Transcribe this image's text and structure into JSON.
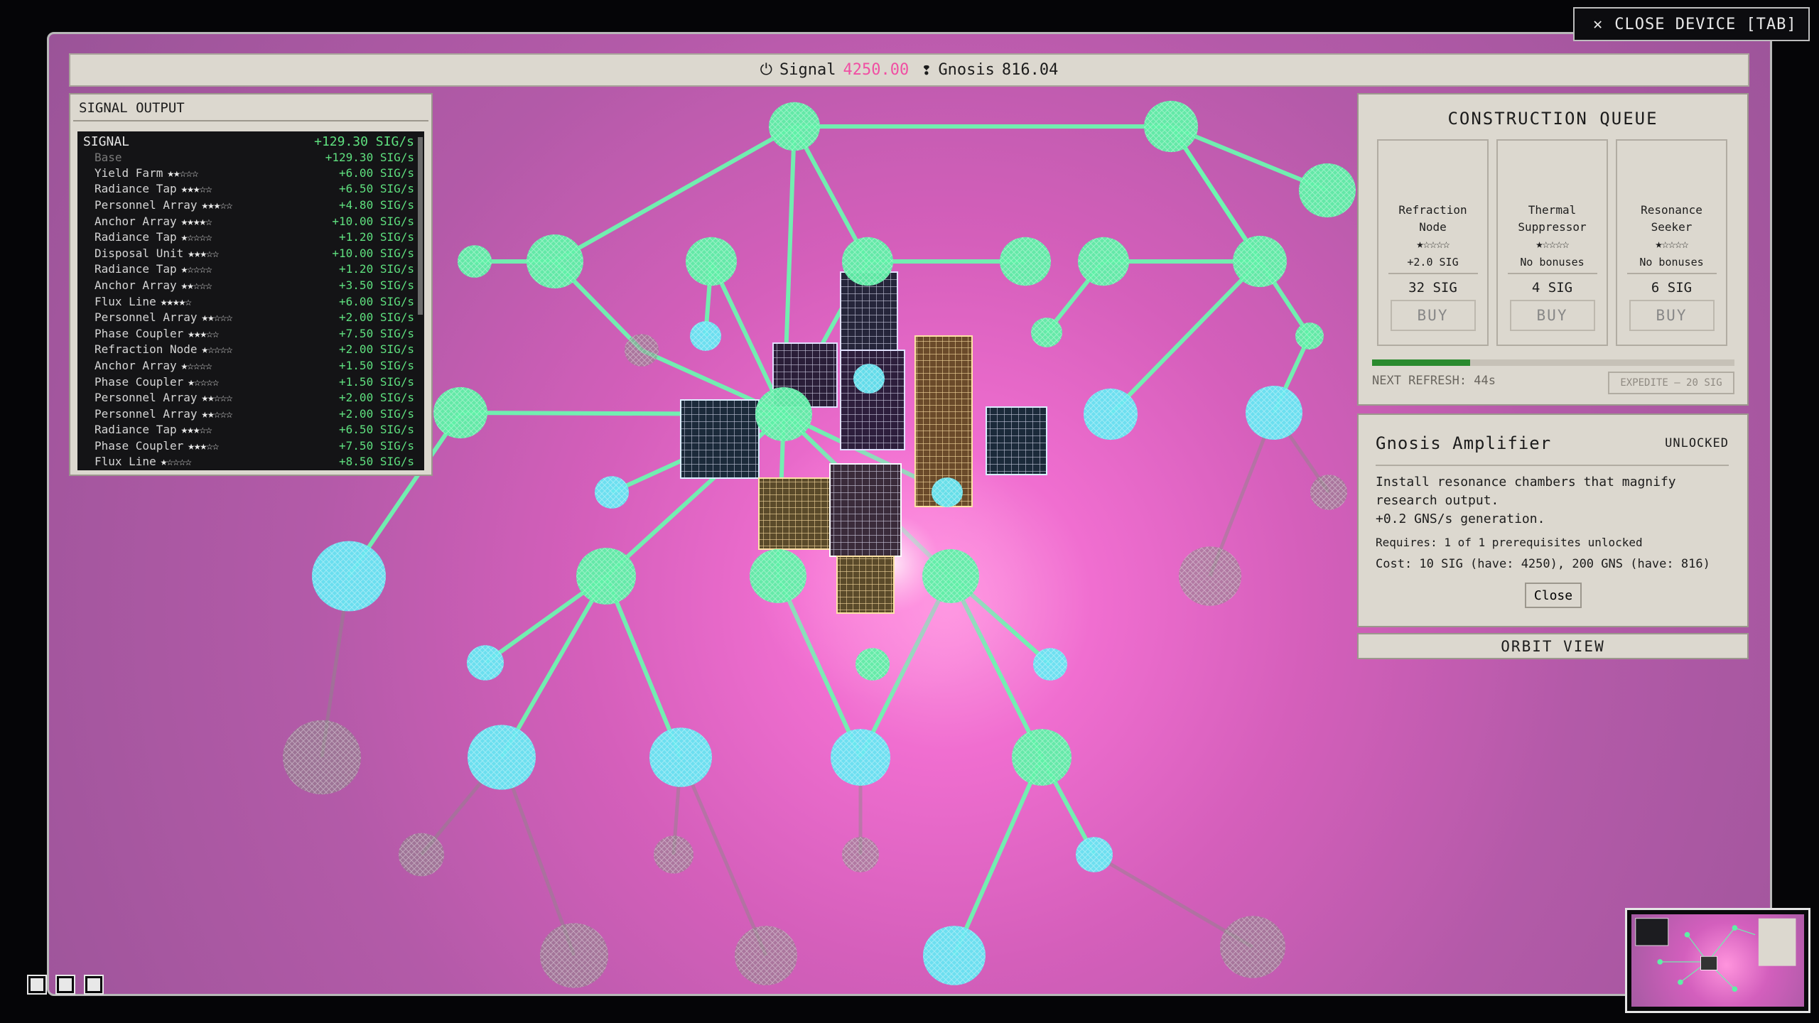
{
  "window": {
    "close_label": "CLOSE DEVICE [TAB]"
  },
  "resources": {
    "signal_label": "Signal",
    "signal_value": "4250.00",
    "gnosis_label": "Gnosis",
    "gnosis_value": "816.04"
  },
  "signal_output": {
    "title": "SIGNAL OUTPUT",
    "head_label": "SIGNAL",
    "head_value": "+129.30 SIG/s",
    "base_label": "Base",
    "base_value": "+129.30 SIG/s",
    "rows": [
      {
        "label": "Yield Farm",
        "stars": "★★☆☆☆",
        "value": "+6.00 SIG/s"
      },
      {
        "label": "Radiance Tap",
        "stars": "★★★☆☆",
        "value": "+6.50 SIG/s"
      },
      {
        "label": "Personnel Array",
        "stars": "★★★☆☆",
        "value": "+4.80 SIG/s"
      },
      {
        "label": "Anchor Array",
        "stars": "★★★★☆",
        "value": "+10.00 SIG/s"
      },
      {
        "label": "Radiance Tap",
        "stars": "★☆☆☆☆",
        "value": "+1.20 SIG/s"
      },
      {
        "label": "Disposal Unit",
        "stars": "★★★☆☆",
        "value": "+10.00 SIG/s"
      },
      {
        "label": "Radiance Tap",
        "stars": "★☆☆☆☆",
        "value": "+1.20 SIG/s"
      },
      {
        "label": "Anchor Array",
        "stars": "★★☆☆☆",
        "value": "+3.50 SIG/s"
      },
      {
        "label": "Flux Line",
        "stars": "★★★★☆",
        "value": "+6.00 SIG/s"
      },
      {
        "label": "Personnel Array",
        "stars": "★★☆☆☆",
        "value": "+2.00 SIG/s"
      },
      {
        "label": "Phase Coupler",
        "stars": "★★★☆☆",
        "value": "+7.50 SIG/s"
      },
      {
        "label": "Refraction Node",
        "stars": "★☆☆☆☆",
        "value": "+2.00 SIG/s"
      },
      {
        "label": "Anchor Array",
        "stars": "★☆☆☆☆",
        "value": "+1.50 SIG/s"
      },
      {
        "label": "Phase Coupler",
        "stars": "★☆☆☆☆",
        "value": "+1.50 SIG/s"
      },
      {
        "label": "Personnel Array",
        "stars": "★★☆☆☆",
        "value": "+2.00 SIG/s"
      },
      {
        "label": "Personnel Array",
        "stars": "★★☆☆☆",
        "value": "+2.00 SIG/s"
      },
      {
        "label": "Radiance Tap",
        "stars": "★★★☆☆",
        "value": "+6.50 SIG/s"
      },
      {
        "label": "Phase Coupler",
        "stars": "★★★☆☆",
        "value": "+7.50 SIG/s"
      },
      {
        "label": "Flux Line",
        "stars": "★☆☆☆☆",
        "value": "+8.50 SIG/s"
      }
    ]
  },
  "queue": {
    "title": "CONSTRUCTION QUEUE",
    "items": [
      {
        "name": "Refraction Node",
        "stars": "★☆☆☆☆",
        "bonus": "+2.0 SIG",
        "cost": "32 SIG",
        "buy": "BUY"
      },
      {
        "name": "Thermal Suppressor",
        "stars": "★☆☆☆☆",
        "bonus": "No bonuses",
        "cost": "4 SIG",
        "buy": "BUY"
      },
      {
        "name": "Resonance Seeker",
        "stars": "★☆☆☆☆",
        "bonus": "No bonuses",
        "cost": "6 SIG",
        "buy": "BUY"
      }
    ],
    "refresh_progress": 0.27,
    "next_refresh": "NEXT REFRESH: 44s",
    "expedite": "EXPEDITE — 20 SIG"
  },
  "detail": {
    "title": "Gnosis Amplifier",
    "status": "UNLOCKED",
    "desc_1": "Install resonance chambers that magnify research output.",
    "desc_2": "+0.2 GNS/s generation.",
    "requires": "Requires: 1 of 1 prerequisites unlocked",
    "cost": "Cost: 10 SIG (have: 4250), 200 GNS (have: 816)",
    "close": "Close"
  },
  "orbit_view": "ORBIT VIEW",
  "colors": {
    "node_green": "#5ef0a6",
    "node_cyan": "#66e6f2",
    "node_locked": "#8a8a86",
    "link": "#6df5b0",
    "accent_pink": "#f04fa3",
    "signal_green": "#5fe07f"
  }
}
